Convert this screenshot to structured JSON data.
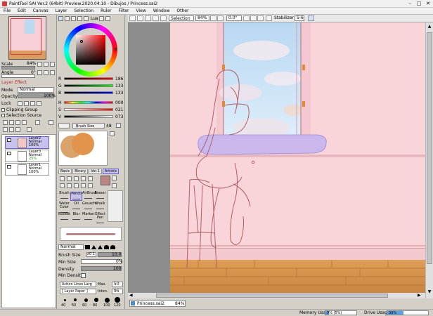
{
  "window": {
    "title": "PaintTool SAI Ver.2 (64bit) Preview.2020.04.10 - Dibujos / Princess.sai2",
    "min": "–",
    "max": "□",
    "close": "✕"
  },
  "menu": [
    "File",
    "Edit",
    "Canvas",
    "Layer",
    "Selection",
    "Ruler",
    "Filter",
    "View",
    "Window",
    "Other"
  ],
  "toolbar": {
    "selection_label": "Selection",
    "zoom": "84%",
    "angle": "0.0°",
    "stabilizer_label": "Stabilizer",
    "stabilizer": "S-6"
  },
  "navigator": {
    "scale_label": "Scale",
    "scale": "84%",
    "angle_label": "Angle",
    "angle": "0°"
  },
  "color": {
    "mode": "Lua",
    "current_hex": "#bc8585",
    "rgb": [
      {
        "label": "R",
        "value": "186"
      },
      {
        "label": "G",
        "value": "133"
      },
      {
        "label": "B",
        "value": "133"
      }
    ],
    "hsv": [
      {
        "label": "H",
        "value": "000"
      },
      {
        "label": "S",
        "value": "021"
      },
      {
        "label": "V",
        "value": "073"
      }
    ]
  },
  "layer_panel": {
    "effect_label": "Layer Effect",
    "mode_label": "Mode",
    "mode": "Normal",
    "opacity_label": "Opacity",
    "opacity": "100%",
    "lock_label": "Lock",
    "clipping": "Clipping Group",
    "selection_source": "Selection Source"
  },
  "layers": [
    {
      "name": "Layer2",
      "mode": "Normal",
      "opacity": "100%",
      "selected": true
    },
    {
      "name": "Layer3",
      "mode": "Normal",
      "opacity": "25%",
      "selected": false
    },
    {
      "name": "Layer1",
      "mode": "Normal",
      "opacity": "100%",
      "selected": false
    }
  ],
  "brush": {
    "size_label": "Brush Size",
    "size": "48",
    "tabs": [
      "Basic",
      "Binary",
      "Ver.1",
      "Artistic"
    ],
    "tools": [
      [
        "Brush",
        "Pencil",
        "AirBrush",
        "Eraser"
      ],
      [
        "Water Color",
        "Oil",
        "Gouache",
        "Chalk"
      ],
      [
        "Bucket",
        "Blur",
        "Marker",
        "Effect Pen"
      ]
    ],
    "blend_mode": "Normal",
    "brush_size_label": "Brush Size",
    "brush_size_mult": "x0.1",
    "brush_size": "10.0",
    "min_size_label": "Min Size",
    "min_size": "0%",
    "density_label": "Density",
    "density": "100",
    "min_density_label": "Min Density",
    "texture": "Action Lines Larg",
    "texture_max": "Max.",
    "texture_val": "50",
    "paper": "[ Layer Paper ]",
    "inten_label": "Inten.",
    "inten": "95",
    "dot_sizes": [
      "40",
      "50",
      "60",
      "80",
      "100",
      "120"
    ]
  },
  "document": {
    "tab": "Princess.sai2",
    "zoom": "84%"
  },
  "status": {
    "memory_label": "Memory Usage",
    "memory": "9% (5%)",
    "drive_label": "Drive Usage",
    "drive": "39%"
  }
}
